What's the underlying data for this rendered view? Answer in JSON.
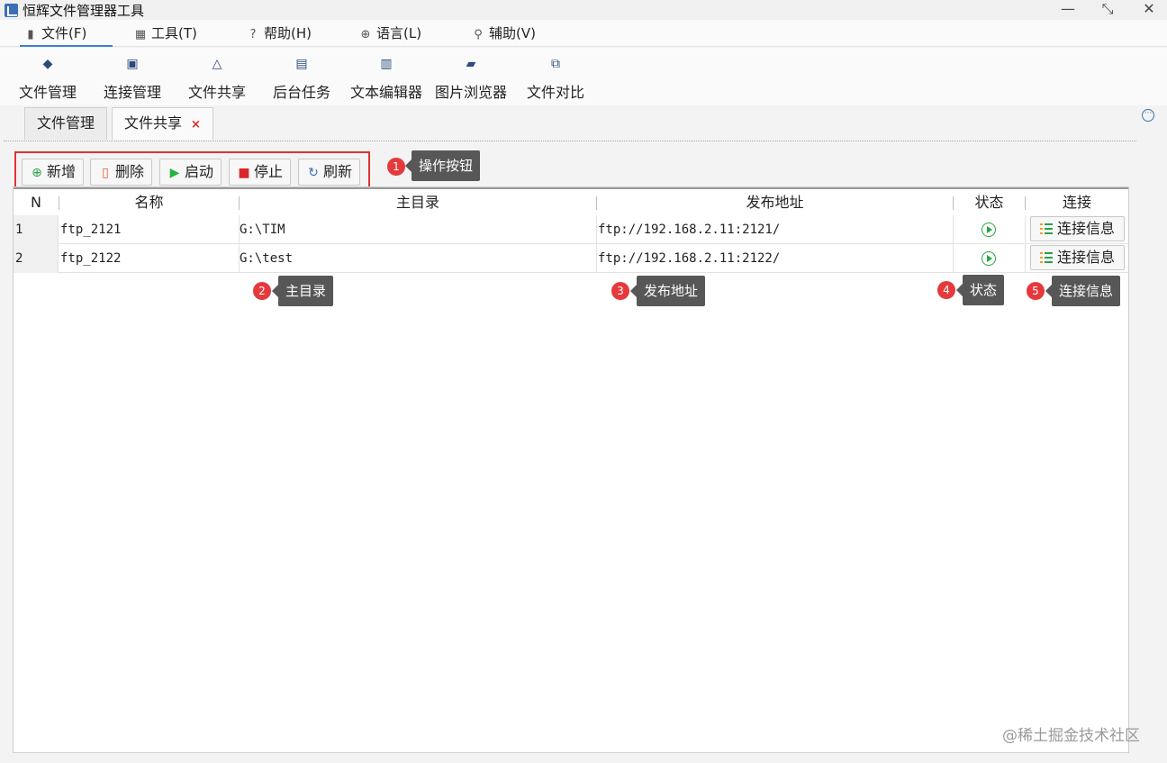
{
  "window": {
    "title": "恒辉文件管理器工具",
    "minimize": "—",
    "maximize": "⤡",
    "close": "✕"
  },
  "menu": {
    "items": [
      {
        "label": "文件(F)",
        "icon": "file-icon"
      },
      {
        "label": "工具(T)",
        "icon": "grid-icon"
      },
      {
        "label": "帮助(H)",
        "icon": "help-icon"
      },
      {
        "label": "语言(L)",
        "icon": "globe-icon"
      },
      {
        "label": "辅助(V)",
        "icon": "wrench-icon"
      }
    ],
    "active_index": 0
  },
  "ribbon": {
    "items": [
      {
        "label": "文件管理",
        "icon": "layers-icon"
      },
      {
        "label": "连接管理",
        "icon": "code-window-icon"
      },
      {
        "label": "文件共享",
        "icon": "share-icon"
      },
      {
        "label": "后台任务",
        "icon": "chart-icon"
      },
      {
        "label": "文本编辑器",
        "icon": "document-icon"
      },
      {
        "label": "图片浏览器",
        "icon": "images-icon"
      },
      {
        "label": "文件对比",
        "icon": "compare-icon"
      }
    ]
  },
  "doc_tabs": {
    "items": [
      {
        "label": "文件管理",
        "closable": false
      },
      {
        "label": "文件共享",
        "closable": true
      }
    ],
    "active_index": 1,
    "close_glyph": "×"
  },
  "toolbar": {
    "add": "新增",
    "delete": "删除",
    "start": "启动",
    "stop": "停止",
    "refresh": "刷新"
  },
  "table": {
    "columns": [
      "N",
      "名称",
      "主目录",
      "发布地址",
      "状态",
      "连接"
    ],
    "rows": [
      {
        "n": "1",
        "name": "ftp_2121",
        "home": "G:\\TIM",
        "address": "ftp://192.168.2.11:2121/",
        "status": "running",
        "action": "连接信息"
      },
      {
        "n": "2",
        "name": "ftp_2122",
        "home": "G:\\test",
        "address": "ftp://192.168.2.11:2122/",
        "status": "running",
        "action": "连接信息"
      }
    ]
  },
  "annotations": [
    {
      "num": "1",
      "text": "操作按钮"
    },
    {
      "num": "2",
      "text": "主目录"
    },
    {
      "num": "3",
      "text": "发布地址"
    },
    {
      "num": "4",
      "text": "状态"
    },
    {
      "num": "5",
      "text": "连接信息"
    }
  ],
  "watermark": "@稀土掘金技术社区",
  "colors": {
    "accent": "#3b7fd6",
    "highlight_box": "#e03333",
    "badge": "#e6393c",
    "callout_bg": "#575757",
    "status_running": "#26a641"
  }
}
